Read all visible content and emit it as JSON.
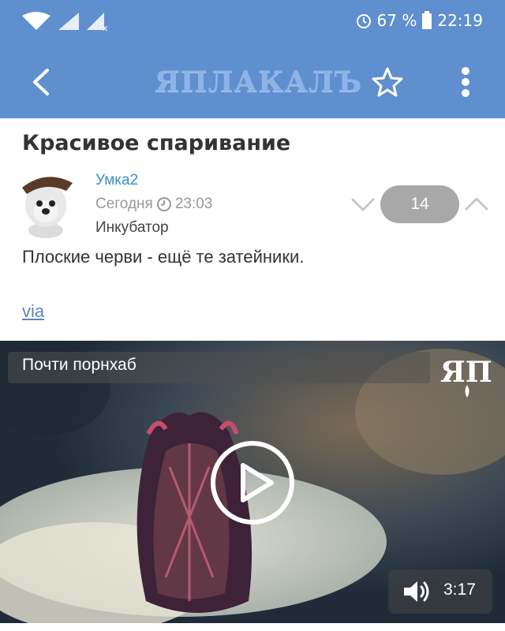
{
  "status_bar": {
    "battery": "67 %",
    "time": "22:19"
  },
  "app_bar": {
    "logo": "ЯПЛАКАЛЪ"
  },
  "post": {
    "title": "Красивое спаривание",
    "author": "Умка2",
    "date": "Сегодня",
    "time": "23:03",
    "section": "Инкубатор",
    "rating": "14",
    "body": "Плоские черви - ещё те затейники.",
    "link": "via"
  },
  "video": {
    "title": "Почти порнхаб",
    "watermark": "ЯП",
    "duration": "3:17"
  },
  "colors": {
    "brand": "#5f8fcf",
    "link": "#3a8fc9"
  }
}
